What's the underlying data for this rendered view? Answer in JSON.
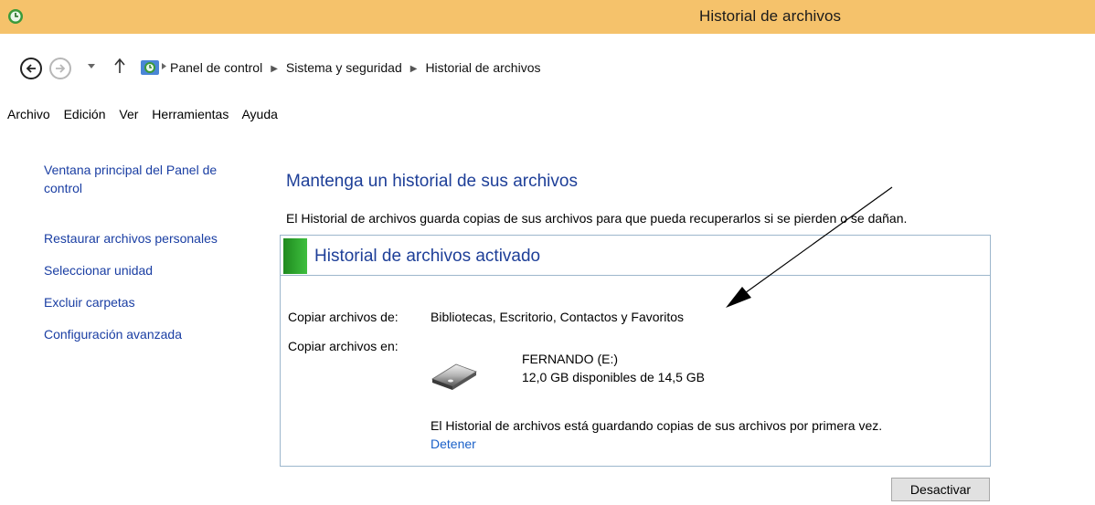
{
  "window": {
    "title": "Historial de archivos",
    "app_icon": "file-history-icon"
  },
  "nav": {
    "back_icon": "back-arrow-icon",
    "forward_icon": "forward-arrow-icon",
    "recent_icon": "chevron-down-icon",
    "up_icon": "up-arrow-icon",
    "breadcrumb": [
      "Panel de control",
      "Sistema y seguridad",
      "Historial de archivos"
    ]
  },
  "menu": {
    "items": [
      "Archivo",
      "Edición",
      "Ver",
      "Herramientas",
      "Ayuda"
    ]
  },
  "sidebar": {
    "links": [
      "Ventana principal del Panel de control",
      "Restaurar archivos personales",
      "Seleccionar unidad",
      "Excluir carpetas",
      "Configuración avanzada"
    ]
  },
  "main": {
    "heading": "Mantenga un historial de sus archivos",
    "description": "El Historial de archivos guarda copias de sus archivos para que pueda recuperarlos si se pierden o se dañan.",
    "panel": {
      "status_title": "Historial de archivos activado",
      "status_color": "#2aa32a",
      "copy_from_label": "Copiar archivos de:",
      "copy_from_value": "Bibliotecas, Escritorio, Contactos y Favoritos",
      "copy_to_label": "Copiar archivos en:",
      "drive_name": "FERNANDO (E:)",
      "drive_space": "12,0 GB disponibles de 14,5 GB",
      "progress_message": "El Historial de archivos está guardando copias de sus archivos por primera vez.",
      "stop_link": "Detener"
    },
    "deactivate_button": "Desactivar"
  },
  "colors": {
    "titlebar": "#f5c26b",
    "link": "#1a3ea3",
    "heading": "#1e3f98"
  }
}
